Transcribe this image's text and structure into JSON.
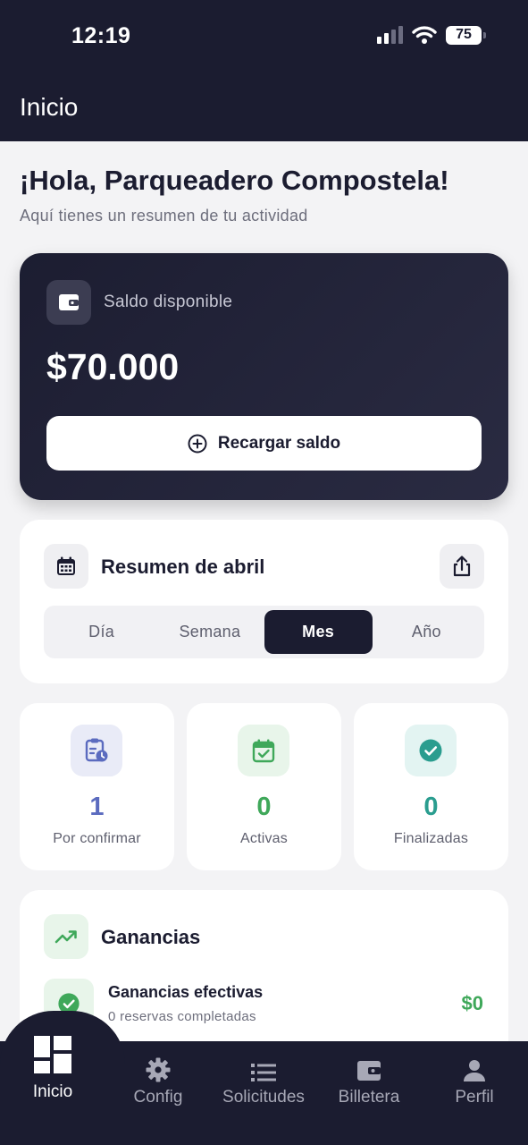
{
  "status_bar": {
    "time": "12:19",
    "battery": "75"
  },
  "header": {
    "title": "Inicio"
  },
  "greeting": {
    "title": "¡Hola, Parqueadero Compostela!",
    "subtitle": "Aquí tienes un resumen de tu actividad"
  },
  "balance": {
    "label": "Saldo disponible",
    "amount": "$70.000",
    "recharge_label": "Recargar saldo"
  },
  "summary": {
    "title": "Resumen de abril",
    "periods": [
      "Día",
      "Semana",
      "Mes",
      "Año"
    ],
    "selected_period": "Mes"
  },
  "stats": [
    {
      "value": "1",
      "label": "Por confirmar",
      "color": "#5b6bbf",
      "bg": "#e9ebf7",
      "icon": "clipboard-clock-icon"
    },
    {
      "value": "0",
      "label": "Activas",
      "color": "#3fa85a",
      "bg": "#e8f5ea",
      "icon": "calendar-check-icon"
    },
    {
      "value": "0",
      "label": "Finalizadas",
      "color": "#2a9d8f",
      "bg": "#e3f4f2",
      "icon": "check-circle-icon"
    }
  ],
  "earnings": {
    "title": "Ganancias",
    "row_title": "Ganancias efectivas",
    "row_subtitle": "0 reservas completadas",
    "row_amount": "$0"
  },
  "nav": [
    {
      "label": "Inicio",
      "icon": "dashboard-icon",
      "active": true
    },
    {
      "label": "Config",
      "icon": "gear-icon",
      "active": false
    },
    {
      "label": "Solicitudes",
      "icon": "list-icon",
      "active": false
    },
    {
      "label": "Billetera",
      "icon": "wallet-icon",
      "active": false
    },
    {
      "label": "Perfil",
      "icon": "person-icon",
      "active": false
    }
  ],
  "colors": {
    "primary": "#1b1c30",
    "accent_green": "#3fa85a",
    "background": "#f3f3f5"
  }
}
